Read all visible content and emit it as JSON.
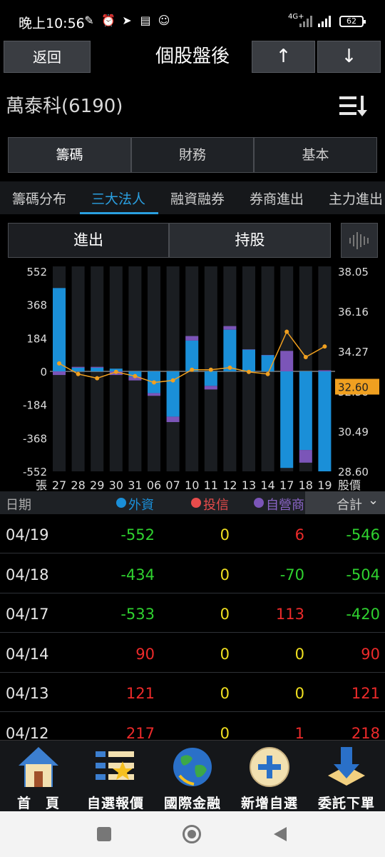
{
  "status": {
    "time": "晚上10:56",
    "battery": "62",
    "signal": "4G+"
  },
  "header": {
    "back_label": "返回",
    "title": "個股盤後",
    "up_label": "↑",
    "down_label": "↓"
  },
  "stock": {
    "name": "萬泰科(6190)"
  },
  "top_tabs": [
    "籌碼",
    "財務",
    "基本"
  ],
  "sub_tabs": [
    "籌碼分布",
    "三大法人",
    "融資融券",
    "券商進出",
    "主力進出"
  ],
  "toggle": [
    "進出",
    "持股"
  ],
  "chart_data": {
    "type": "bar",
    "left_axis_ticks": [
      "552",
      "368",
      "184",
      "0",
      "-184",
      "-368",
      "-552"
    ],
    "right_axis_ticks": [
      "38.05",
      "36.16",
      "34.27",
      "32.38",
      "30.49",
      "28.60"
    ],
    "current_price_label": "32.60",
    "left_unit": "張",
    "right_unit": "股價",
    "categories": [
      "27",
      "28",
      "29",
      "30",
      "31",
      "06",
      "07",
      "10",
      "11",
      "12",
      "13",
      "14",
      "17",
      "18",
      "19"
    ],
    "ylim": [
      -552,
      552
    ],
    "price_ylim": [
      28.6,
      38.05
    ],
    "series": [
      {
        "name": "外資",
        "color": "#1a8fd8",
        "values": [
          460,
          20,
          20,
          15,
          -30,
          -120,
          -250,
          170,
          -80,
          230,
          121,
          90,
          -533,
          -434,
          -552
        ]
      },
      {
        "name": "自營商",
        "color": "#7b55b8",
        "values": [
          -20,
          5,
          5,
          -20,
          -20,
          -15,
          -30,
          25,
          -20,
          20,
          0,
          0,
          113,
          -70,
          6
        ]
      },
      {
        "name": "股價",
        "color": "#f0a020",
        "values": [
          33.7,
          33.2,
          33.0,
          33.3,
          33.1,
          32.8,
          32.9,
          33.4,
          33.4,
          33.5,
          33.3,
          33.2,
          35.2,
          34.0,
          34.5
        ]
      }
    ]
  },
  "table": {
    "headers": {
      "date": "日期",
      "foreign": "外資",
      "trust": "投信",
      "dealer": "自營商",
      "total": "合計"
    },
    "rows": [
      {
        "date": "04/19",
        "foreign": "-552",
        "trust": "0",
        "dealer": "6",
        "total": "-546"
      },
      {
        "date": "04/18",
        "foreign": "-434",
        "trust": "0",
        "dealer": "-70",
        "total": "-504"
      },
      {
        "date": "04/17",
        "foreign": "-533",
        "trust": "0",
        "dealer": "113",
        "total": "-420"
      },
      {
        "date": "04/14",
        "foreign": "90",
        "trust": "0",
        "dealer": "0",
        "total": "90"
      },
      {
        "date": "04/13",
        "foreign": "121",
        "trust": "0",
        "dealer": "0",
        "total": "121"
      },
      {
        "date": "04/12",
        "foreign": "217",
        "trust": "0",
        "dealer": "1",
        "total": "218"
      }
    ]
  },
  "bottom_nav": [
    "首　頁",
    "自選報價",
    "國際金融",
    "新增自選",
    "委託下單"
  ]
}
